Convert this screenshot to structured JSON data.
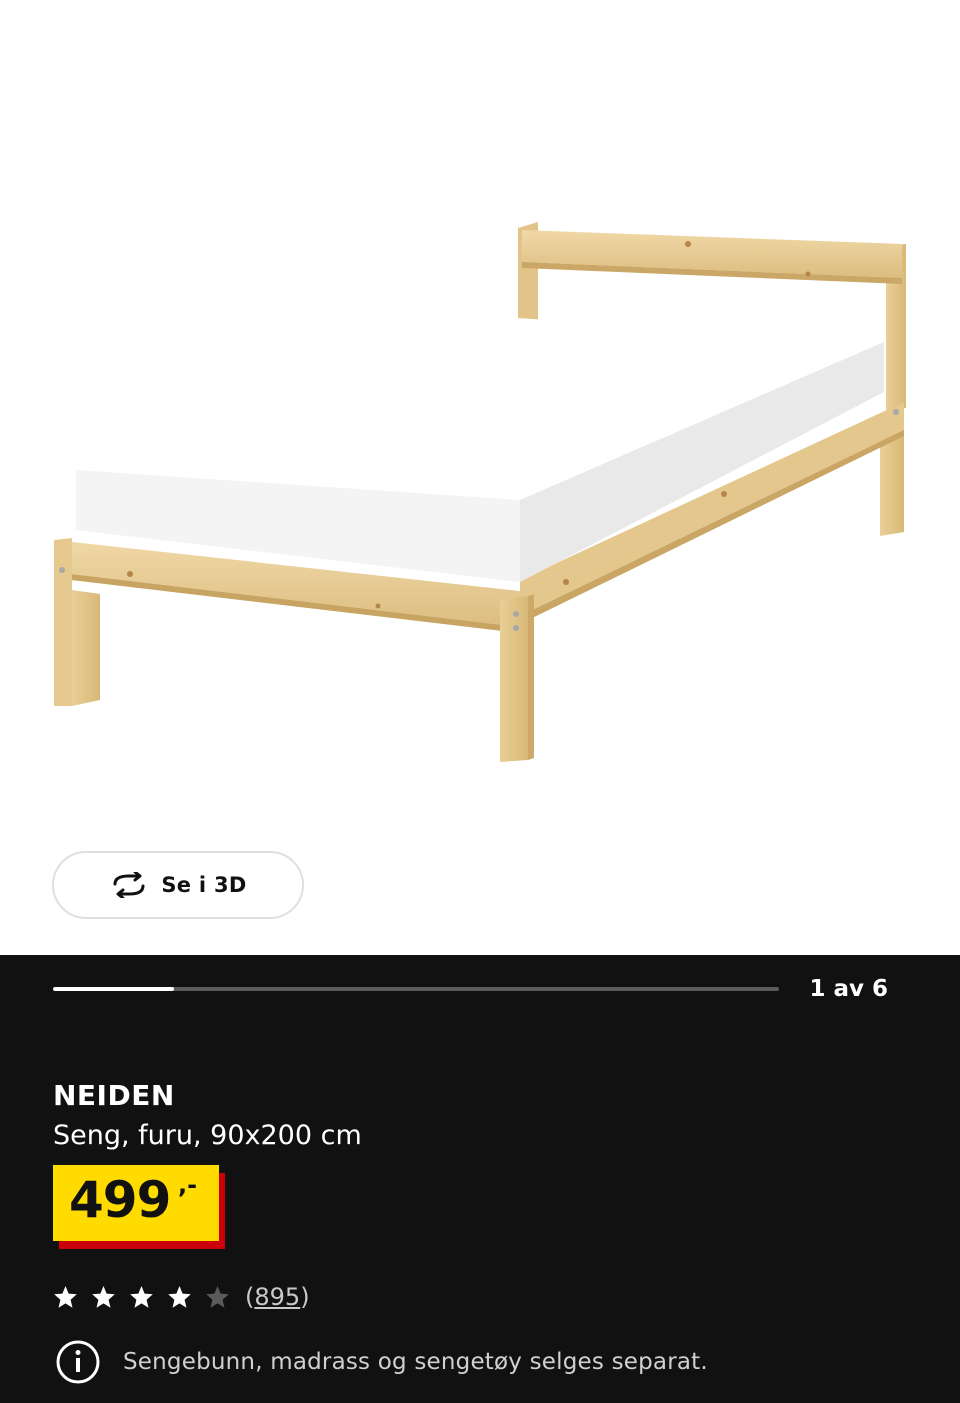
{
  "gallery": {
    "view_3d_label": "Se i 3D",
    "page_indicator": "1 av 6",
    "current_image": 1,
    "total_images": 6
  },
  "product": {
    "name": "NEIDEN",
    "description": "Seng, furu, 90x200 cm",
    "price": "499",
    "price_suffix": ",-",
    "rating": 4,
    "rating_max": 5,
    "review_count_open": "(",
    "review_count": "895",
    "review_count_close": ")",
    "note": "Sengebunn, madrass og sengetøy selges separat."
  },
  "colors": {
    "panel_background": "#111111",
    "price_yellow": "#ffdb00",
    "price_red": "#cc0008",
    "wood": "#e8cc91"
  },
  "icons": {
    "view_3d": "rotate-3d-icon",
    "star": "star-icon",
    "info": "info-icon"
  }
}
